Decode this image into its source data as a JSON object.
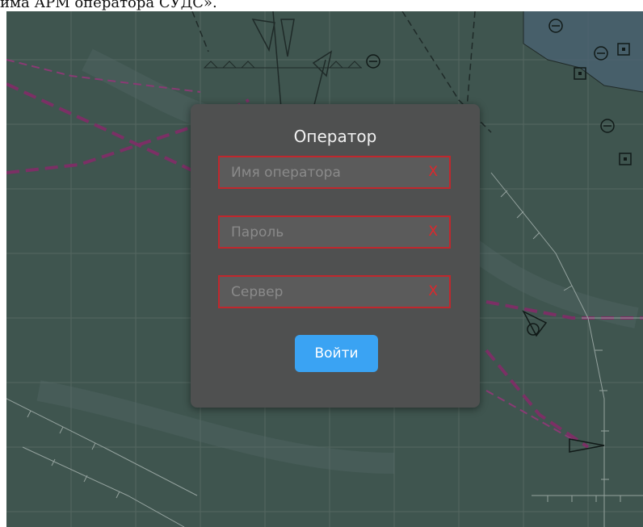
{
  "page": {
    "caption": "има АРМ оператора СУДС»."
  },
  "dialog": {
    "title": "Оператор",
    "fields": [
      {
        "name": "operator-name-field",
        "placeholder": "Имя оператора",
        "value": "",
        "clear_label": "X"
      },
      {
        "name": "password-field",
        "placeholder": "Пароль",
        "value": "",
        "clear_label": "X"
      },
      {
        "name": "server-field",
        "placeholder": "Сервер",
        "value": "",
        "clear_label": "X"
      }
    ],
    "submit_label": "Войти"
  },
  "colors": {
    "map_background": "#3f554f",
    "dialog_background": "#4f5050",
    "field_border_error": "#c0272d",
    "clear_icon": "#e0262b",
    "button_accent": "#3aa3f3"
  },
  "icons": [
    "clear-x-icon",
    "map-buoy-icon",
    "map-beacon-icon",
    "map-vessel-icon"
  ]
}
